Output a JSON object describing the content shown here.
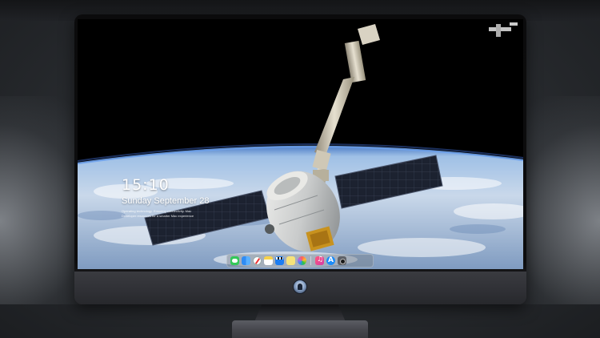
{
  "lock_screen": {
    "time": "15:10",
    "date": "Sunday September 28",
    "note_line1": "Operating technology. Ensuring connectivity. Mac",
    "note_line2": "Developer resources for a smarter Mac experience"
  },
  "dock": {
    "items": [
      {
        "icon": "messages-icon"
      },
      {
        "icon": "finder-icon"
      },
      {
        "icon": "safari-icon"
      },
      {
        "icon": "notes-icon"
      },
      {
        "icon": "clapperboard-icon"
      },
      {
        "icon": "stickies-icon"
      },
      {
        "icon": "photos-icon"
      },
      {
        "icon": "music-icon"
      },
      {
        "icon": "app-store-icon"
      },
      {
        "icon": "camera-icon"
      }
    ]
  },
  "wallpaper": {
    "subject": "spacecraft with robotic arm over earth"
  },
  "colors": {
    "space": "#000000",
    "earth_blue": "#7fa6d6",
    "monitor_chin": "#2f3035",
    "dock_background": "#78808a"
  }
}
